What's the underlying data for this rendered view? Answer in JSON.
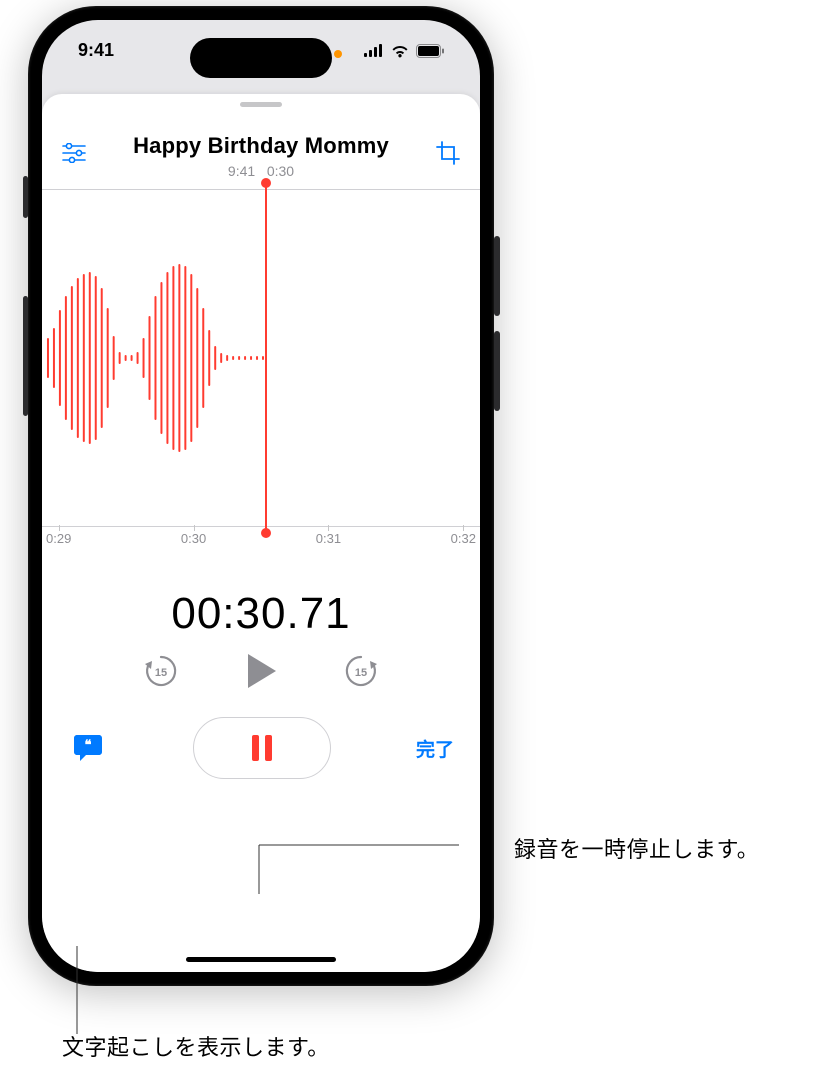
{
  "status": {
    "time": "9:41"
  },
  "header": {
    "title": "Happy Birthday Mommy",
    "meta_time": "9:41",
    "meta_duration": "0:30"
  },
  "waveform": {
    "ticks": [
      "0:29",
      "0:30",
      "0:31",
      "0:32"
    ]
  },
  "timer": "00:30.71",
  "controls": {
    "skip_seconds": "15",
    "done_label": "完了"
  },
  "callouts": {
    "pause": "録音を一時停止します。",
    "transcribe": "文字起こしを表示します。"
  }
}
